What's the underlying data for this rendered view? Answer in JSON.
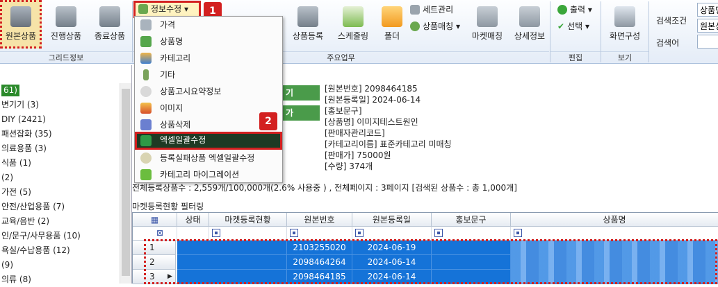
{
  "ribbon": {
    "grid_group": {
      "label": "그리드정보",
      "buttons": [
        "원본상품",
        "진행상품",
        "종료상품"
      ]
    },
    "main_group": {
      "label": "주요업무",
      "dropdown": "정보수정",
      "buttons": [
        "상품등록",
        "스케줄링",
        "폴더",
        "마켓매칭",
        "상세정보"
      ],
      "small": [
        "세트관리",
        "상품매칭"
      ]
    },
    "edit_group": {
      "label": "편집",
      "items": [
        "출력",
        "선택"
      ]
    },
    "view_group": {
      "label": "보기",
      "button": "화면구성"
    },
    "search": {
      "condition_label": "검색조건",
      "keyword_label": "검색어",
      "condition_value": "상품명",
      "condition_value2": "원본상"
    }
  },
  "badges": {
    "one": "1",
    "two": "2"
  },
  "menu": {
    "items": [
      "가격",
      "상품명",
      "카테고리",
      "기타",
      "상품고시요약정보",
      "이미지",
      "상품삭제",
      "엑셀일괄수정",
      "등록실패상품 엑셀일괄수정",
      "카테고리 마이그레이션"
    ],
    "highlighted": 7
  },
  "tree": {
    "items": [
      "61)",
      "변기기 (3)",
      "DIY (2421)",
      "패션잡화 (35)",
      "의료용품 (3)",
      "식품 (1)",
      "(2)",
      "가전 (5)",
      "안전/산업용품 (7)",
      "교육/음반 (2)",
      "인/문구/사무용품 (10)",
      "욕실/수납용품 (12)",
      "(9)",
      "의류 (8)"
    ]
  },
  "info": {
    "lines": [
      "[원본번호] 2098464185",
      "[원본등록일] 2024-06-14",
      "[홍보문구]",
      "[상품명] 이미지테스트원인",
      "[판매자관리코드]",
      "[카테고리이름] 표준카테고리 미매칭",
      "[판매가] 75000원",
      "[수량] 374개"
    ],
    "btn1": "기",
    "btn2": "가"
  },
  "summary": "전체등록상품수 : 2,559개/100,000개(2.6% 사용중 ) , 전체페이지 : 3페이지 [검색된 상품수 : 총 1,000개]",
  "filter_label": "마켓등록현황 필터링",
  "grid": {
    "columns": [
      "상태",
      "마켓등록현황",
      "원본번호",
      "원본등록일",
      "홍보문구",
      "상품명"
    ],
    "rows": [
      {
        "n": "1",
        "id": "2103255020",
        "date": "2024-06-19"
      },
      {
        "n": "2",
        "id": "2098464264",
        "date": "2024-06-14"
      },
      {
        "n": "3",
        "id": "2098464185",
        "date": "2024-06-14"
      }
    ]
  },
  "colors": {
    "accent": "#d32020",
    "selection": "#1573d8",
    "green": "#2b8a2b"
  }
}
